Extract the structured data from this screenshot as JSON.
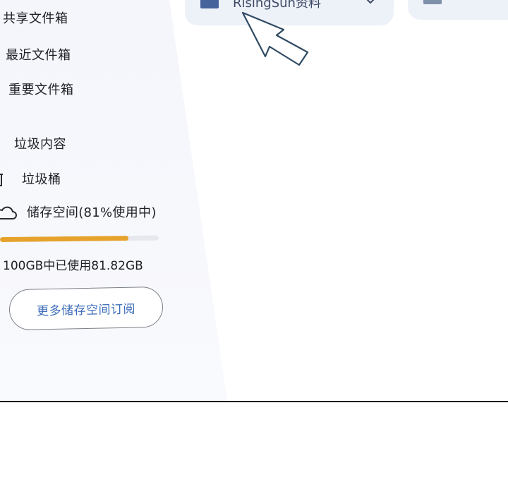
{
  "sidebar": {
    "items": [
      {
        "label": "共享文件箱",
        "icon": "shared-folder-icon"
      },
      {
        "label": "最近文件箱",
        "icon": "recent-folder-icon"
      },
      {
        "label": "重要文件箱",
        "icon": "important-folder-icon"
      },
      {
        "label": "垃圾内容",
        "icon": "spam-icon"
      },
      {
        "label": "垃圾桶",
        "icon": "trash-icon"
      }
    ],
    "storage": {
      "label": "储存空间(81%使用中)",
      "icon": "cloud-icon",
      "percent_used": 81,
      "detail": "100GB中已使用81.82GB",
      "upgrade_label": "更多储存空间订阅"
    }
  },
  "main": {
    "cards": [
      {
        "title": "RisingSun资料",
        "icon": "folder-icon"
      },
      {
        "title": "",
        "icon": "folder-icon"
      }
    ],
    "cursor": "pointer-cursor-icon"
  },
  "colors": {
    "sidebar_bg": "#f4f6fb",
    "progress_fill": "#e6a22b",
    "progress_track": "#e6e8ee",
    "button_text": "#3b6bb8",
    "card_bg": "#edf1f8"
  }
}
